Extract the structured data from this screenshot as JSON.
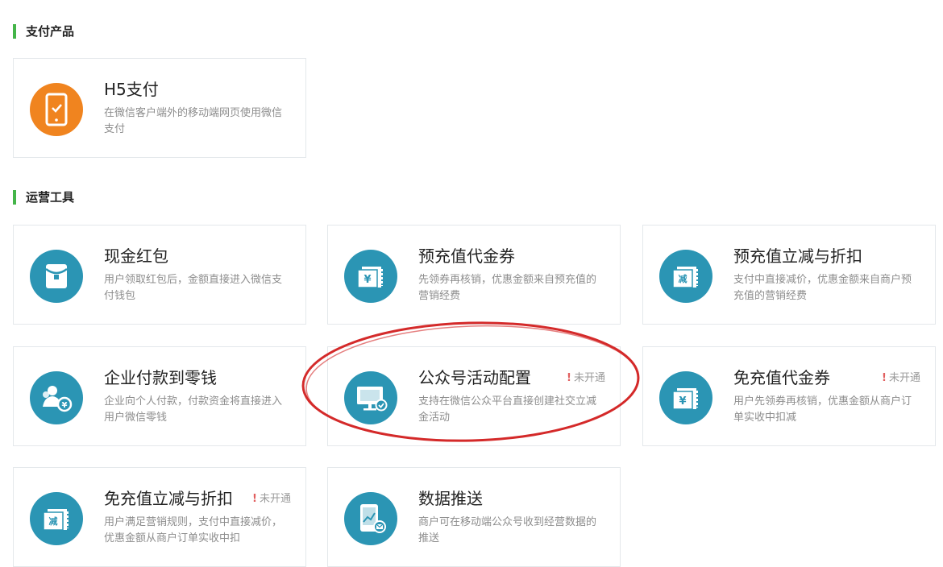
{
  "sections": [
    {
      "title": "支付产品"
    },
    {
      "title": "运营工具"
    }
  ],
  "cards": [
    {
      "title": "H5支付",
      "desc": "在微信客户端外的移动端网页使用微信支付",
      "icon": "phone-check-icon",
      "icon_color": "#f0841f"
    },
    {
      "title": "现金红包",
      "desc": "用户领取红包后，金额直接进入微信支付钱包",
      "icon": "red-packet-icon",
      "icon_color": "#2b95b4"
    },
    {
      "title": "预充值代金券",
      "desc": "先领券再核销，优惠金额来自预充值的营销经费",
      "icon": "yuan-voucher-icon",
      "icon_color": "#2b95b4"
    },
    {
      "title": "预充值立减与折扣",
      "desc": "支付中直接减价，优惠金额来自商户预充值的营销经费",
      "icon": "discount-voucher-icon",
      "icon_color": "#2b95b4"
    },
    {
      "title": "企业付款到零钱",
      "desc": "企业向个人付款，付款资金将直接进入用户微信零钱",
      "icon": "users-payment-icon",
      "icon_color": "#2b95b4"
    },
    {
      "title": "公众号活动配置",
      "desc": "支持在微信公众平台直接创建社交立减金活动",
      "icon": "monitor-config-icon",
      "icon_color": "#2b95b4",
      "status": "未开通",
      "status_mark": "!"
    },
    {
      "title": "免充值代金券",
      "desc": "用户先领券再核销，优惠金额从商户订单实收中扣减",
      "icon": "yuan-voucher-icon",
      "icon_color": "#2b95b4",
      "status": "未开通",
      "status_mark": "!"
    },
    {
      "title": "免充值立减与折扣",
      "desc": "用户满足营销规则，支付中直接减价，优惠金额从商户订单实收中扣",
      "icon": "discount-voucher-icon",
      "icon_color": "#2b95b4",
      "status": "未开通",
      "status_mark": "!"
    },
    {
      "title": "数据推送",
      "desc": "商户可在移动端公众号收到经营数据的推送",
      "icon": "data-push-icon",
      "icon_color": "#2b95b4"
    }
  ],
  "highlight_color": "#d42a2a"
}
